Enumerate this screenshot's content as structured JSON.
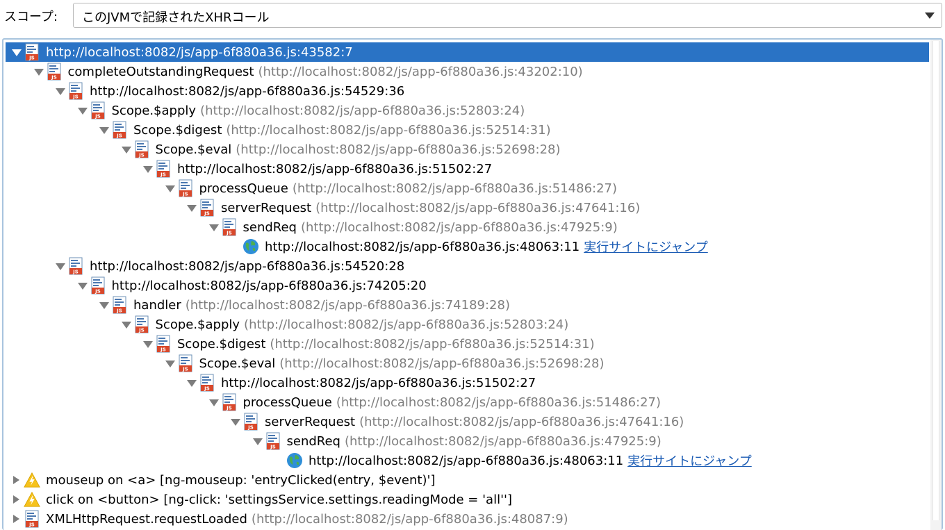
{
  "scope": {
    "label": "スコープ:",
    "selected": "このJVMで記録されたXHRコール"
  },
  "colors": {
    "selection": "#2a73c5",
    "location_text": "#7f7f7f",
    "link": "#1a5bb4"
  },
  "tree": {
    "rows": [
      {
        "depth": 0,
        "toggle": "open",
        "icon": "js-file-icon",
        "name": "http://localhost:8082/js/app-6f880a36.js:43582:7",
        "location": "",
        "link": "",
        "selected": true
      },
      {
        "depth": 1,
        "toggle": "open",
        "icon": "js-file-icon",
        "name": "completeOutstandingRequest",
        "location": "(http://localhost:8082/js/app-6f880a36.js:43202:10)",
        "link": ""
      },
      {
        "depth": 2,
        "toggle": "open",
        "icon": "js-file-icon",
        "name": "http://localhost:8082/js/app-6f880a36.js:54529:36",
        "location": "",
        "link": ""
      },
      {
        "depth": 3,
        "toggle": "open",
        "icon": "js-file-icon",
        "name": "Scope.$apply",
        "location": "(http://localhost:8082/js/app-6f880a36.js:52803:24)",
        "link": ""
      },
      {
        "depth": 4,
        "toggle": "open",
        "icon": "js-file-icon",
        "name": "Scope.$digest",
        "location": "(http://localhost:8082/js/app-6f880a36.js:52514:31)",
        "link": ""
      },
      {
        "depth": 5,
        "toggle": "open",
        "icon": "js-file-icon",
        "name": "Scope.$eval",
        "location": "(http://localhost:8082/js/app-6f880a36.js:52698:28)",
        "link": ""
      },
      {
        "depth": 6,
        "toggle": "open",
        "icon": "js-file-icon",
        "name": "http://localhost:8082/js/app-6f880a36.js:51502:27",
        "location": "",
        "link": ""
      },
      {
        "depth": 7,
        "toggle": "open",
        "icon": "js-file-icon",
        "name": "processQueue",
        "location": "(http://localhost:8082/js/app-6f880a36.js:51486:27)",
        "link": ""
      },
      {
        "depth": 8,
        "toggle": "open",
        "icon": "js-file-icon",
        "name": "serverRequest",
        "location": "(http://localhost:8082/js/app-6f880a36.js:47641:16)",
        "link": ""
      },
      {
        "depth": 9,
        "toggle": "open",
        "icon": "js-file-icon",
        "name": "sendReq",
        "location": "(http://localhost:8082/js/app-6f880a36.js:47925:9)",
        "link": ""
      },
      {
        "depth": 10,
        "toggle": "none",
        "icon": "globe-icon",
        "name": "http://localhost:8082/js/app-6f880a36.js:48063:11",
        "location": "",
        "link": "実行サイトにジャンプ"
      },
      {
        "depth": 2,
        "toggle": "open",
        "icon": "js-file-icon",
        "name": "http://localhost:8082/js/app-6f880a36.js:54520:28",
        "location": "",
        "link": ""
      },
      {
        "depth": 3,
        "toggle": "open",
        "icon": "js-file-icon",
        "name": "http://localhost:8082/js/app-6f880a36.js:74205:20",
        "location": "",
        "link": ""
      },
      {
        "depth": 4,
        "toggle": "open",
        "icon": "js-file-icon",
        "name": "handler",
        "location": "(http://localhost:8082/js/app-6f880a36.js:74189:28)",
        "link": ""
      },
      {
        "depth": 5,
        "toggle": "open",
        "icon": "js-file-icon",
        "name": "Scope.$apply",
        "location": "(http://localhost:8082/js/app-6f880a36.js:52803:24)",
        "link": ""
      },
      {
        "depth": 6,
        "toggle": "open",
        "icon": "js-file-icon",
        "name": "Scope.$digest",
        "location": "(http://localhost:8082/js/app-6f880a36.js:52514:31)",
        "link": ""
      },
      {
        "depth": 7,
        "toggle": "open",
        "icon": "js-file-icon",
        "name": "Scope.$eval",
        "location": "(http://localhost:8082/js/app-6f880a36.js:52698:28)",
        "link": ""
      },
      {
        "depth": 8,
        "toggle": "open",
        "icon": "js-file-icon",
        "name": "http://localhost:8082/js/app-6f880a36.js:51502:27",
        "location": "",
        "link": ""
      },
      {
        "depth": 9,
        "toggle": "open",
        "icon": "js-file-icon",
        "name": "processQueue",
        "location": "(http://localhost:8082/js/app-6f880a36.js:51486:27)",
        "link": ""
      },
      {
        "depth": 10,
        "toggle": "open",
        "icon": "js-file-icon",
        "name": "serverRequest",
        "location": "(http://localhost:8082/js/app-6f880a36.js:47641:16)",
        "link": ""
      },
      {
        "depth": 11,
        "toggle": "open",
        "icon": "js-file-icon",
        "name": "sendReq",
        "location": "(http://localhost:8082/js/app-6f880a36.js:47925:9)",
        "link": ""
      },
      {
        "depth": 12,
        "toggle": "none",
        "icon": "globe-icon",
        "name": "http://localhost:8082/js/app-6f880a36.js:48063:11",
        "location": "",
        "link": "実行サイトにジャンプ"
      },
      {
        "depth": 0,
        "toggle": "closed",
        "icon": "warning-icon",
        "name": "mouseup on <a> [ng-mouseup: 'entryClicked(entry, $event)']",
        "location": "",
        "link": ""
      },
      {
        "depth": 0,
        "toggle": "closed",
        "icon": "warning-icon",
        "name": "click on <button> [ng-click: 'settingsService.settings.readingMode = 'all'']",
        "location": "",
        "link": ""
      },
      {
        "depth": 0,
        "toggle": "closed",
        "icon": "js-file-icon",
        "name": "XMLHttpRequest.requestLoaded",
        "location": "(http://localhost:8082/js/app-6f880a36.js:48087:9)",
        "link": ""
      }
    ]
  }
}
